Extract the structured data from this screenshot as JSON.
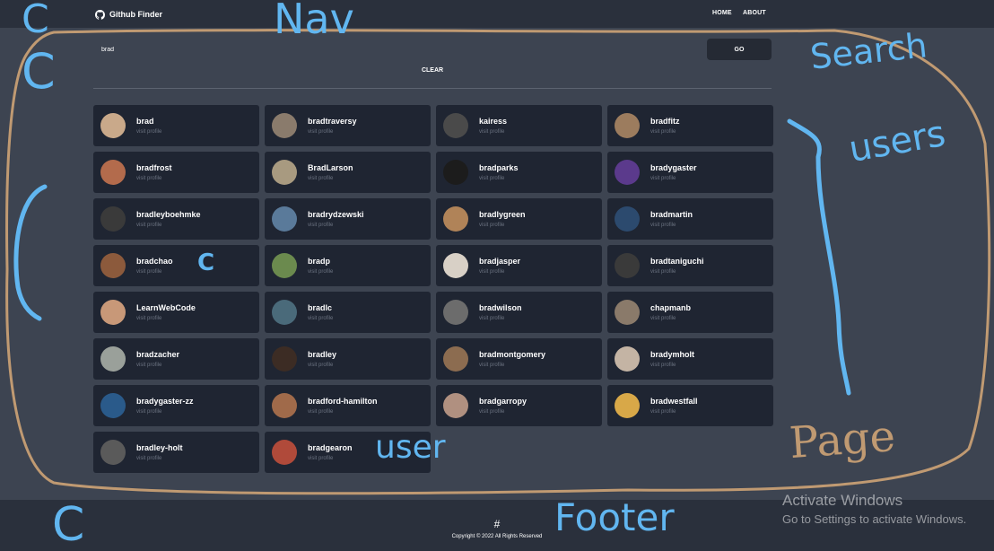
{
  "nav": {
    "brand": "Github Finder",
    "links": [
      "HOME",
      "ABOUT"
    ]
  },
  "search": {
    "value": "brad",
    "go_label": "GO",
    "clear_label": "CLEAR"
  },
  "users": [
    {
      "login": "brad",
      "link": "visit profile",
      "color": "#c9a98a"
    },
    {
      "login": "bradtraversy",
      "link": "visit profile",
      "color": "#8a7b6c"
    },
    {
      "login": "kairess",
      "link": "visit profile",
      "color": "#4a4a4a"
    },
    {
      "login": "bradfitz",
      "link": "visit profile",
      "color": "#9c7c5e"
    },
    {
      "login": "bradfrost",
      "link": "visit profile",
      "color": "#b36b4c"
    },
    {
      "login": "BradLarson",
      "link": "visit profile",
      "color": "#a89a80"
    },
    {
      "login": "bradparks",
      "link": "visit profile",
      "color": "#1c1c1c"
    },
    {
      "login": "bradygaster",
      "link": "visit profile",
      "color": "#5b3a8c"
    },
    {
      "login": "bradleyboehmke",
      "link": "visit profile",
      "color": "#3a3a3a"
    },
    {
      "login": "bradrydzewski",
      "link": "visit profile",
      "color": "#5a7a9a"
    },
    {
      "login": "bradlygreen",
      "link": "visit profile",
      "color": "#b08358"
    },
    {
      "login": "bradmartin",
      "link": "visit profile",
      "color": "#2c4a6e"
    },
    {
      "login": "bradchao",
      "link": "visit profile",
      "color": "#8c5a3c"
    },
    {
      "login": "bradp",
      "link": "visit profile",
      "color": "#6b8a4e"
    },
    {
      "login": "bradjasper",
      "link": "visit profile",
      "color": "#d8d0c6"
    },
    {
      "login": "bradtaniguchi",
      "link": "visit profile",
      "color": "#3a3a3a"
    },
    {
      "login": "LearnWebCode",
      "link": "visit profile",
      "color": "#c89878"
    },
    {
      "login": "bradlc",
      "link": "visit profile",
      "color": "#4a6a7a"
    },
    {
      "login": "bradwilson",
      "link": "visit profile",
      "color": "#6c6c6c"
    },
    {
      "login": "chapmanb",
      "link": "visit profile",
      "color": "#8a7a6a"
    },
    {
      "login": "bradzacher",
      "link": "visit profile",
      "color": "#9aa09a"
    },
    {
      "login": "bradley",
      "link": "visit profile",
      "color": "#3c2c24"
    },
    {
      "login": "bradmontgomery",
      "link": "visit profile",
      "color": "#8c6c50"
    },
    {
      "login": "bradymholt",
      "link": "visit profile",
      "color": "#c4b4a4"
    },
    {
      "login": "bradygaster-zz",
      "link": "visit profile",
      "color": "#2a5a8a"
    },
    {
      "login": "bradford-hamilton",
      "link": "visit profile",
      "color": "#a06a4a"
    },
    {
      "login": "bradgarropy",
      "link": "visit profile",
      "color": "#b09080"
    },
    {
      "login": "bradwestfall",
      "link": "visit profile",
      "color": "#d8a848"
    },
    {
      "login": "bradley-holt",
      "link": "visit profile",
      "color": "#5a5a5a"
    },
    {
      "login": "bradgearon",
      "link": "visit profile",
      "color": "#b04a3a"
    }
  ],
  "footer": {
    "hash": "#",
    "copyright": "Copyright © 2022 All Rights Reserved"
  },
  "watermark": {
    "title": "Activate Windows",
    "subtitle": "Go to Settings to activate Windows."
  },
  "annotations": {
    "nav": "Nav",
    "search": "Search",
    "users": "users",
    "user": "user",
    "page": "Page",
    "footer": "Footer",
    "component_mark": "C",
    "ink_blue": "#61b6f0",
    "ink_tan": "#c09a72"
  },
  "colors": {
    "page_bg": "#3d4451",
    "nav_bg": "#2a303c",
    "card_bg": "#1f2532",
    "button_bg": "#252a34"
  }
}
